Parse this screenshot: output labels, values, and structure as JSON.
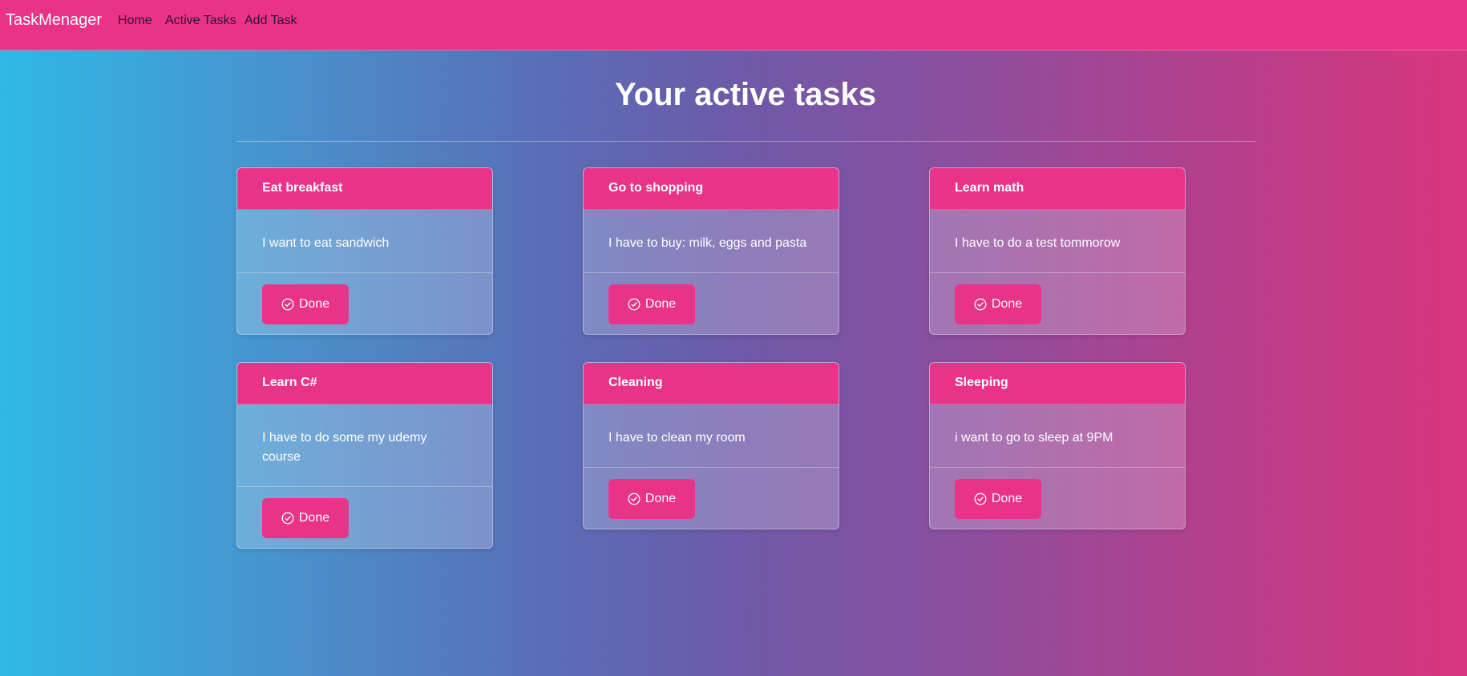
{
  "navbar": {
    "brand": "TaskMenager",
    "links": [
      "Home",
      "Active Tasks",
      "Add Task"
    ]
  },
  "page": {
    "title": "Your active tasks"
  },
  "tasks": [
    {
      "title": "Eat breakfast",
      "description": "I want to eat sandwich",
      "button": "Done"
    },
    {
      "title": "Go to shopping",
      "description": "I have to buy: milk, eggs and pasta",
      "button": "Done"
    },
    {
      "title": "Learn math",
      "description": "I have to do a test tommorow",
      "button": "Done"
    },
    {
      "title": "Learn C#",
      "description": "I have to do some my udemy course",
      "button": "Done"
    },
    {
      "title": "Cleaning",
      "description": "I have to clean my room",
      "button": "Done"
    },
    {
      "title": "Sleeping",
      "description": "i want to go to sleep at 9PM",
      "button": "Done"
    }
  ],
  "colors": {
    "accent": "#e93388",
    "gradient_left": "#2fb9e6",
    "gradient_right": "#d8357c"
  },
  "icons": {
    "done_button": "check-circle-icon"
  }
}
